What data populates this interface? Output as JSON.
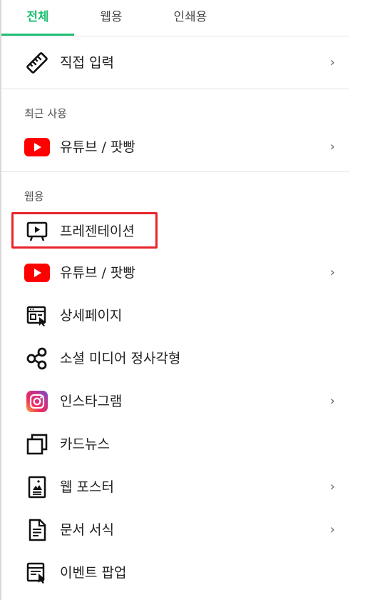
{
  "tabs": [
    {
      "label": "전체",
      "active": true
    },
    {
      "label": "웹용",
      "active": false
    },
    {
      "label": "인쇄용",
      "active": false
    }
  ],
  "direct_input": {
    "label": "직접 입력",
    "icon": "ruler-icon"
  },
  "recent": {
    "section_label": "최근 사용",
    "items": [
      {
        "label": "유튜브 / 팟빵",
        "icon": "youtube-icon"
      }
    ]
  },
  "web": {
    "section_label": "웹용",
    "items": [
      {
        "label": "프레젠테이션",
        "icon": "presentation-icon",
        "highlighted": true
      },
      {
        "label": "유튜브 / 팟빵",
        "icon": "youtube-icon"
      },
      {
        "label": "상세페이지",
        "icon": "detail-page-icon"
      },
      {
        "label": "소셜 미디어 정사각형",
        "icon": "share-icon"
      },
      {
        "label": "인스타그램",
        "icon": "instagram-icon"
      },
      {
        "label": "카드뉴스",
        "icon": "card-news-icon"
      },
      {
        "label": "웹 포스터",
        "icon": "poster-icon"
      },
      {
        "label": "문서 서식",
        "icon": "document-icon"
      },
      {
        "label": "이벤트 팝업",
        "icon": "event-popup-icon"
      }
    ]
  },
  "chevron": "›",
  "colors": {
    "accent": "#1fbf74",
    "highlight": "#e8242b",
    "youtube": "#ff0000"
  }
}
